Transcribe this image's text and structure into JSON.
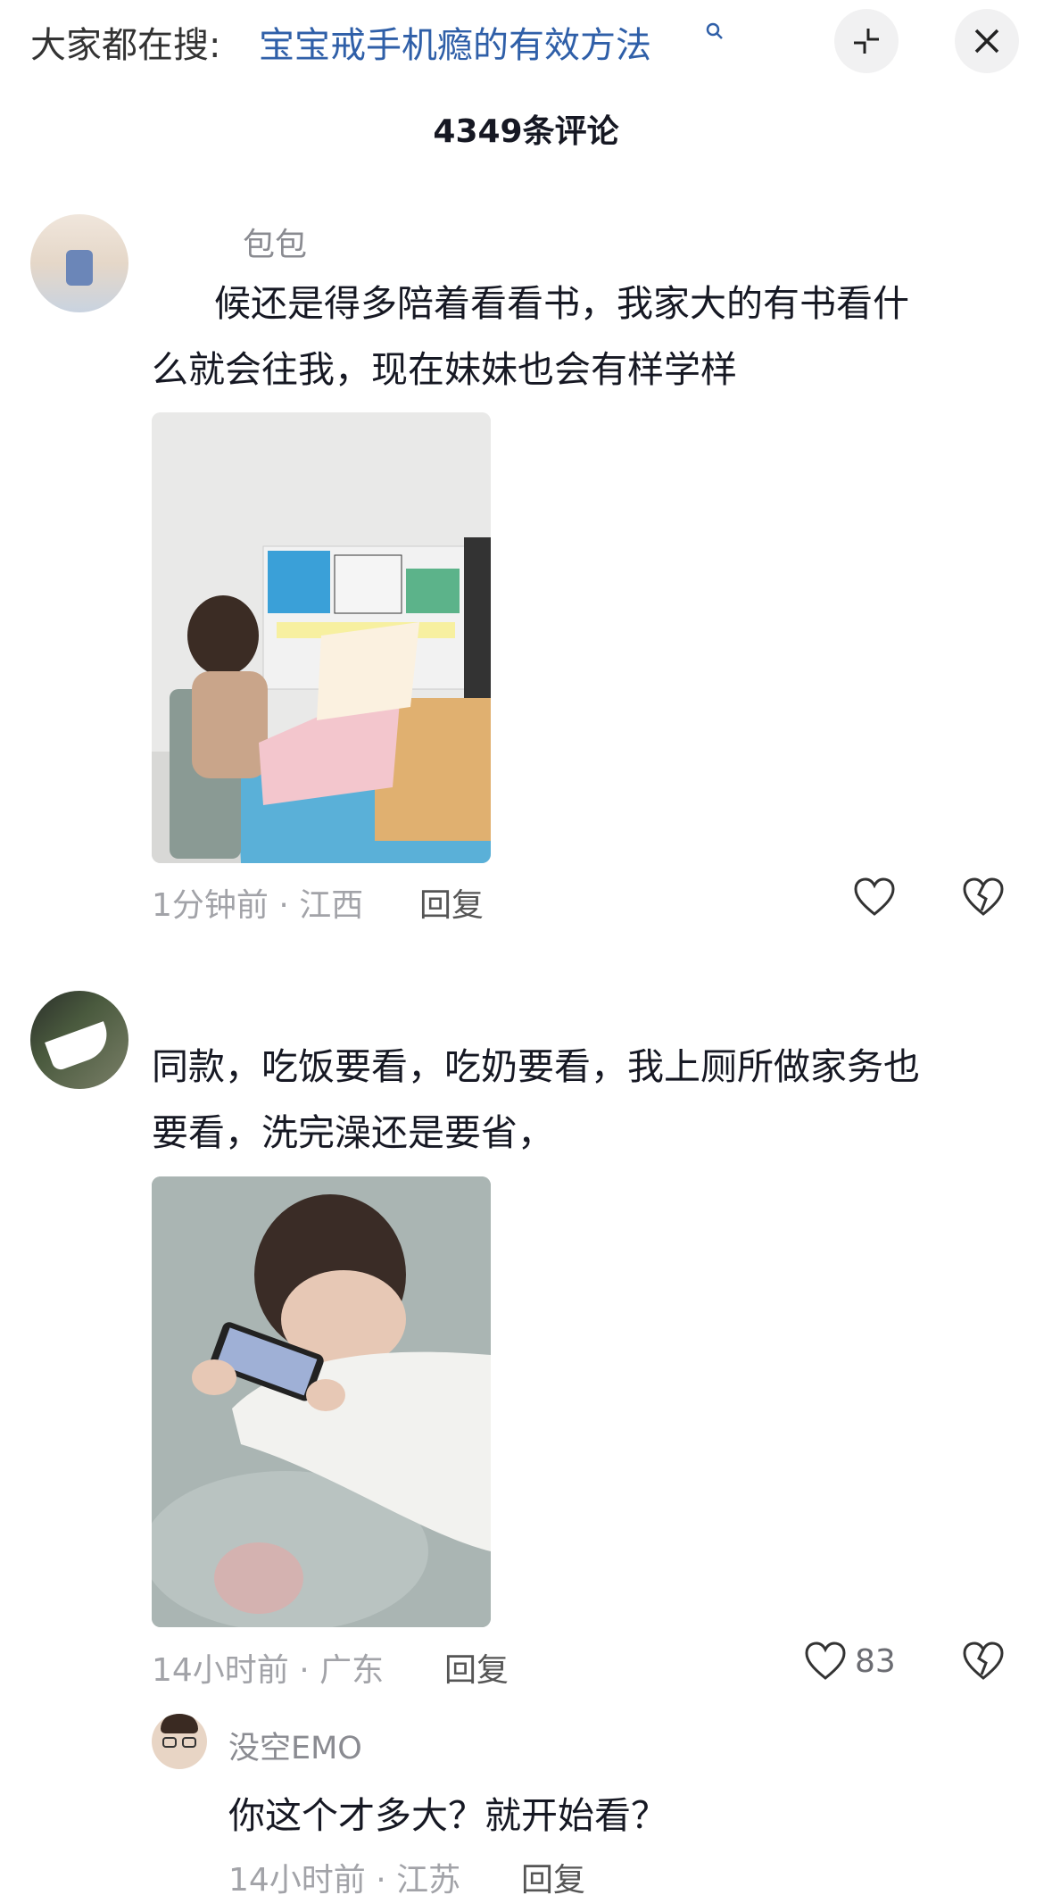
{
  "search": {
    "prefix": "大家都在搜:",
    "query": "宝宝戒手机瘾的有效方法"
  },
  "header": {
    "comment_count": "4349条评论"
  },
  "comments": [
    {
      "username": "包包",
      "text_line1": "候还是得多陪着看看书，我家大的有书看什",
      "text_line2": "么就会往我，现在妹妹也会有样学样",
      "time_location": "1分钟前 · 江西",
      "reply_label": "回复",
      "like_count": ""
    },
    {
      "username": "",
      "text_line1": "同款，吃饭要看，吃奶要看，我上厕所做家务也",
      "text_line2": "要看，洗完澡还是要省，",
      "time_location": "14小时前 · 广东",
      "reply_label": "回复",
      "like_count": "83"
    }
  ],
  "replies": [
    {
      "username": "没空EMO",
      "text": "你这个才多大？就开始看？",
      "time_location": "14小时前 · 江苏",
      "reply_label": "回复"
    }
  ],
  "colors": {
    "link_blue": "#2f5fa8",
    "meta_gray": "#a2a3a8",
    "text_dark": "#161823"
  }
}
